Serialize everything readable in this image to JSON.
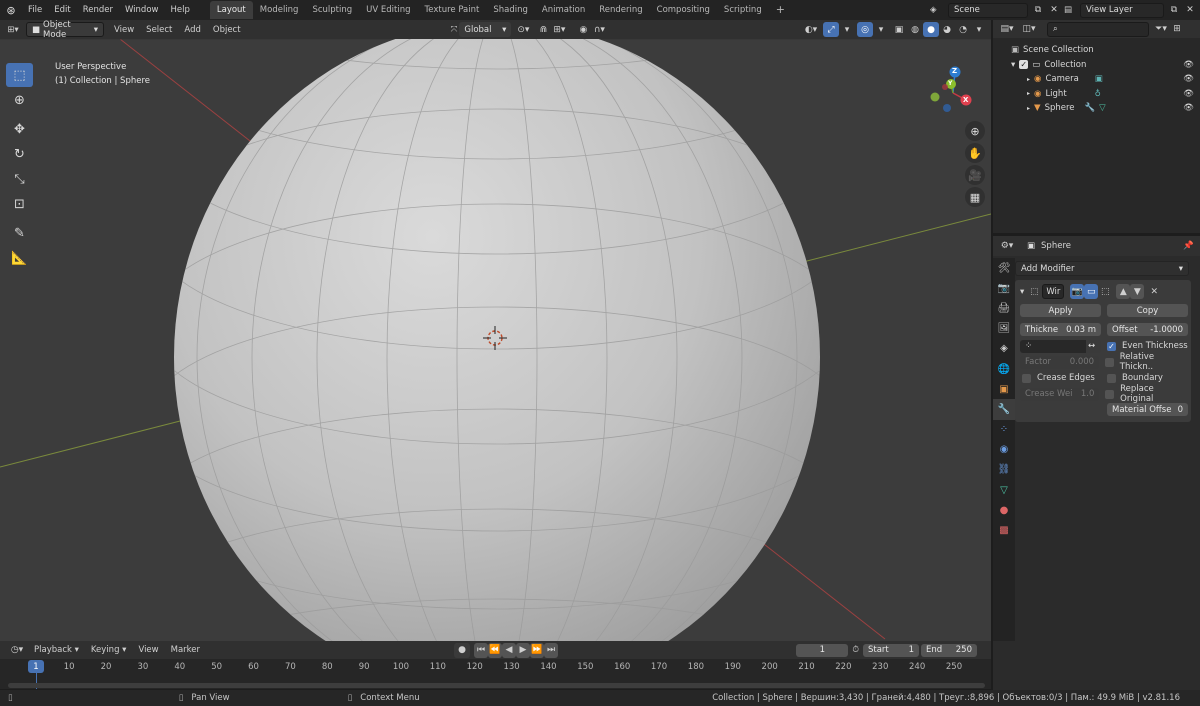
{
  "topbar": {
    "menus": [
      "File",
      "Edit",
      "Render",
      "Window",
      "Help"
    ],
    "workspaces": [
      "Layout",
      "Modeling",
      "Sculpting",
      "UV Editing",
      "Texture Paint",
      "Shading",
      "Animation",
      "Rendering",
      "Compositing",
      "Scripting"
    ],
    "active_workspace": "Layout",
    "add_tab": "+",
    "scene": "Scene",
    "view_layer": "View Layer"
  },
  "viewport_header": {
    "mode": "Object Mode",
    "menus": [
      "View",
      "Select",
      "Add",
      "Object"
    ],
    "transform_orientation": "Global",
    "options": "Options"
  },
  "viewport": {
    "perspective": "User Perspective",
    "collection_info": "(1) Collection | Sphere",
    "gizmo": {
      "z": "Z",
      "y": "Y",
      "x": "X"
    }
  },
  "outliner": {
    "root": "Scene Collection",
    "collection": "Collection",
    "items": [
      {
        "name": "Camera"
      },
      {
        "name": "Light"
      },
      {
        "name": "Sphere"
      }
    ]
  },
  "properties": {
    "object_name": "Sphere",
    "add_modifier": "Add Modifier",
    "modifier": {
      "name": "Wir",
      "apply": "Apply",
      "copy": "Copy",
      "thickness_label": "Thickne",
      "thickness_value": "0.03 m",
      "offset_label": "Offset",
      "offset_value": "-1.0000",
      "even_thickness": "Even Thickness",
      "factor_label": "Factor",
      "factor_value": "0.000",
      "relative_thickness": "Relative Thickn..",
      "crease_edges": "Crease Edges",
      "boundary": "Boundary",
      "crease_weight_label": "Crease Wei",
      "crease_weight_value": "1.0",
      "replace_original": "Replace Original",
      "material_offset_label": "Material Offse",
      "material_offset_value": "0"
    }
  },
  "timeline": {
    "menus": [
      "Playback",
      "Keying",
      "View",
      "Marker"
    ],
    "current_frame": "1",
    "start_label": "Start",
    "start_value": "1",
    "end_label": "End",
    "end_value": "250",
    "ticks": [
      "1",
      "10",
      "20",
      "30",
      "40",
      "50",
      "60",
      "70",
      "80",
      "90",
      "100",
      "110",
      "120",
      "130",
      "140",
      "150",
      "160",
      "170",
      "180",
      "190",
      "200",
      "210",
      "220",
      "230",
      "240",
      "250"
    ]
  },
  "statusbar": {
    "pan": "Pan View",
    "context": "Context Menu",
    "stats": "Collection | Sphere | Вершин:3,430 | Граней:4,480 | Треуг.:8,896 | Объектов:0/3 | Пам.: 49.9 MiB | v2.81.16"
  },
  "colors": {
    "accent": "#4772b3",
    "header": "#303030",
    "viewport_bg": "#3c3c3c",
    "sphere": "#b9b9b9"
  }
}
